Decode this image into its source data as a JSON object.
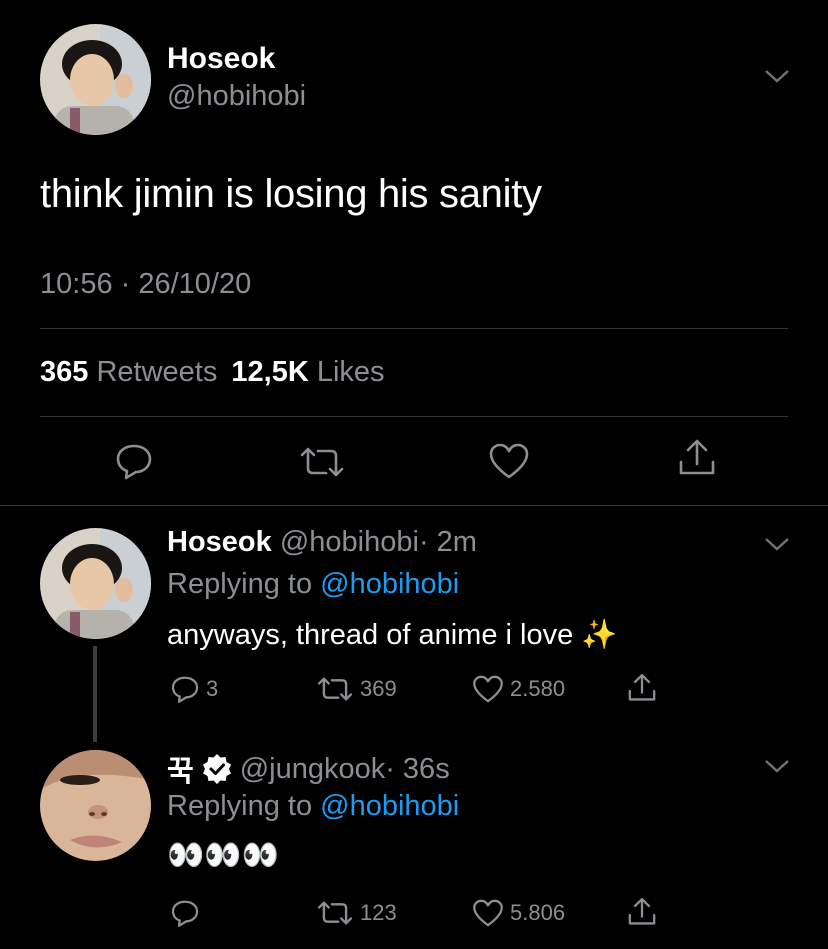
{
  "main_tweet": {
    "display_name": "Hoseok",
    "handle": "@hobihobi",
    "text": "think jimin is losing his sanity",
    "timestamp": "10:56 · 26/10/20",
    "retweets_count": "365",
    "retweets_label": "Retweets",
    "likes_count": "12,5K",
    "likes_label": "Likes"
  },
  "replies": [
    {
      "display_name": "Hoseok",
      "handle": "@hobihobi",
      "time": "· 2m",
      "replying_prefix": "Replying to",
      "replying_handle": "@hobihobi",
      "text": "anyways, thread of anime i love ✨",
      "reply_count": "3",
      "retweet_count": "369",
      "like_count": "2.580"
    },
    {
      "display_name": "꾹",
      "verified": true,
      "handle": "@jungkook",
      "time": "· 36s",
      "replying_prefix": "Replying to",
      "replying_handle": "@hobihobi",
      "text": "👀👀👀",
      "reply_count": "",
      "retweet_count": "123",
      "like_count": "5.806"
    }
  ],
  "colors": {
    "background": "#000000",
    "muted": "#8b8f94",
    "link": "#1d9bf0",
    "divider": "#2f3336"
  }
}
